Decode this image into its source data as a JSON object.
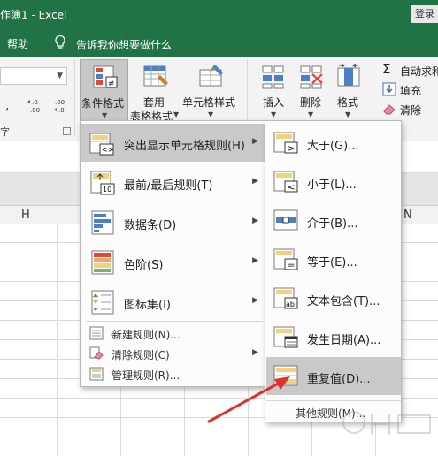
{
  "window": {
    "title": "作簿1  -  Excel",
    "login_label": "登录"
  },
  "tellbar": {
    "help_tab": "帮助",
    "tell_me_placeholder": "告诉我你想要做什么"
  },
  "ribbon": {
    "number_group_label": "字",
    "number_format_value": "",
    "comma_glyph": ",",
    "increase_decimal": "←.0\n.00",
    "decrease_decimal": ".00\n→.0",
    "conditional_formatting": "条件格式",
    "format_as_table_line1": "套用",
    "format_as_table_line2": "表格格式",
    "cell_styles": "单元格样式",
    "insert": "插入",
    "delete": "删除",
    "format": "格式",
    "autosum": "自动求和",
    "fill": "填充",
    "clear": "清除"
  },
  "grid": {
    "column_headers": [
      "H",
      "N"
    ]
  },
  "cf_menu": {
    "items": [
      {
        "label": "突出显示单元格规则(H)",
        "icon": "highlight-cells-rules-icon",
        "highlighted": true,
        "has_submenu": true
      },
      {
        "label": "最前/最后规则(T)",
        "icon": "top-bottom-rules-icon",
        "highlighted": false,
        "has_submenu": true
      },
      {
        "label": "数据条(D)",
        "icon": "data-bars-icon",
        "highlighted": false,
        "has_submenu": true
      },
      {
        "label": "色阶(S)",
        "icon": "color-scales-icon",
        "highlighted": false,
        "has_submenu": true
      },
      {
        "label": "图标集(I)",
        "icon": "icon-sets-icon",
        "highlighted": false,
        "has_submenu": true
      }
    ],
    "small_items": [
      {
        "label": "新建规则(N)...",
        "icon": "new-rule-icon",
        "has_submenu": false
      },
      {
        "label": "清除规则(C)",
        "icon": "clear-rules-icon",
        "has_submenu": true
      },
      {
        "label": "管理规则(R)...",
        "icon": "manage-rules-icon",
        "has_submenu": false
      }
    ]
  },
  "highlight_submenu": {
    "items": [
      {
        "label": "大于(G)...",
        "icon": "greater-than-icon",
        "highlighted": false
      },
      {
        "label": "小于(L)...",
        "icon": "less-than-icon",
        "highlighted": false
      },
      {
        "label": "介于(B)...",
        "icon": "between-icon",
        "highlighted": false
      },
      {
        "label": "等于(E)...",
        "icon": "equal-to-icon",
        "highlighted": false
      },
      {
        "label": "文本包含(T)...",
        "icon": "text-contains-icon",
        "highlighted": false
      },
      {
        "label": "发生日期(A)...",
        "icon": "date-occurring-icon",
        "highlighted": false
      },
      {
        "label": "重复值(D)...",
        "icon": "duplicate-values-icon",
        "highlighted": true
      }
    ],
    "more_rules": "其他规则(M)..."
  },
  "colors": {
    "excel_green": "#217346",
    "menu_highlight": "#c9c9c9",
    "annotation_arrow": "#e0302a"
  }
}
